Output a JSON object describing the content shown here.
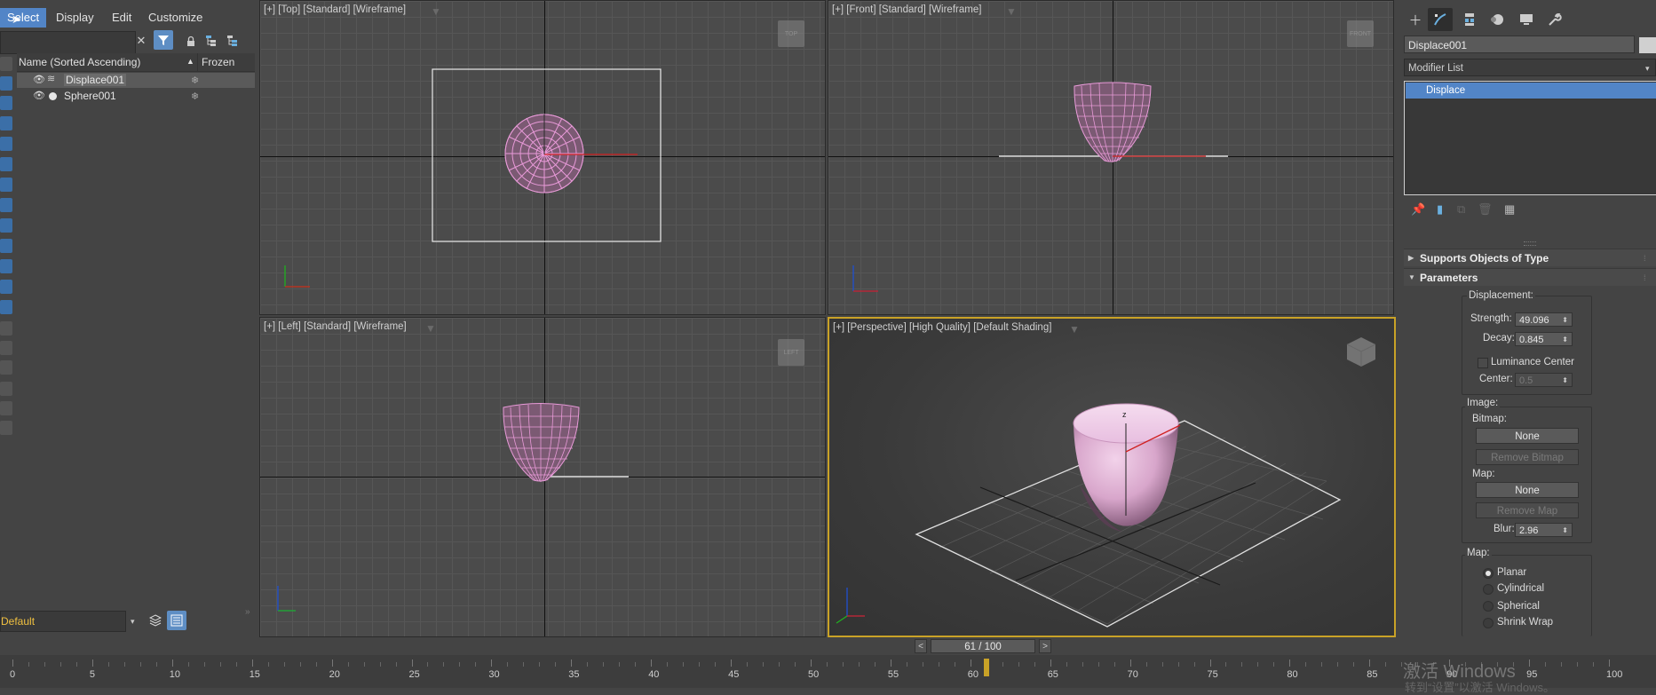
{
  "menu": {
    "items": [
      "Select",
      "Display",
      "Edit",
      "Customize"
    ],
    "active": "Select"
  },
  "explorer": {
    "column_name": "Name (Sorted Ascending)",
    "column_sort_arrow": "▲",
    "column_frozen": "Frozen",
    "rows": [
      {
        "name": "Displace001",
        "selected": true
      },
      {
        "name": "Sphere001",
        "selected": false
      }
    ],
    "layer": "Default"
  },
  "viewports": {
    "top": {
      "label": "[+] [Top] [Standard] [Wireframe]",
      "cube": "TOP"
    },
    "front": {
      "label": "[+] [Front] [Standard] [Wireframe]",
      "cube": "FRONT"
    },
    "left": {
      "label": "[+] [Left] [Standard] [Wireframe]",
      "cube": "LEFT"
    },
    "perspective": {
      "label": "[+] [Perspective] [High Quality] [Default Shading]"
    }
  },
  "command_panel": {
    "object_name": "Displace001",
    "modifier_list": "Modifier List",
    "stack": [
      "Displace"
    ],
    "rollouts": {
      "supports": "Supports Objects of Type",
      "parameters": "Parameters"
    },
    "displacement": {
      "label": "Displacement:",
      "strength_label": "Strength:",
      "strength": "49.096",
      "decay_label": "Decay:",
      "decay": "0.845",
      "luminance_center": "Luminance Center",
      "center_label": "Center:",
      "center": "0.5"
    },
    "image": {
      "label": "Image:",
      "bitmap_label": "Bitmap:",
      "bitmap_button": "None",
      "remove_bitmap": "Remove Bitmap",
      "map_label": "Map:",
      "map_button": "None",
      "remove_map": "Remove Map",
      "blur_label": "Blur:",
      "blur": "2.96"
    },
    "map": {
      "label": "Map:",
      "options": [
        "Planar",
        "Cylindrical",
        "Spherical",
        "Shrink Wrap"
      ],
      "selected": "Planar"
    }
  },
  "timeline": {
    "frame": "61 / 100",
    "current": 61,
    "max": 100,
    "labels": [
      "0",
      "5",
      "10",
      "15",
      "20",
      "25",
      "30",
      "35",
      "40",
      "45",
      "50",
      "55",
      "60",
      "65",
      "70",
      "75",
      "80",
      "85",
      "90",
      "95",
      "100"
    ]
  },
  "watermark": {
    "line1": "激活 Windows",
    "line2": "转到“设置”以激活 Windows。"
  }
}
